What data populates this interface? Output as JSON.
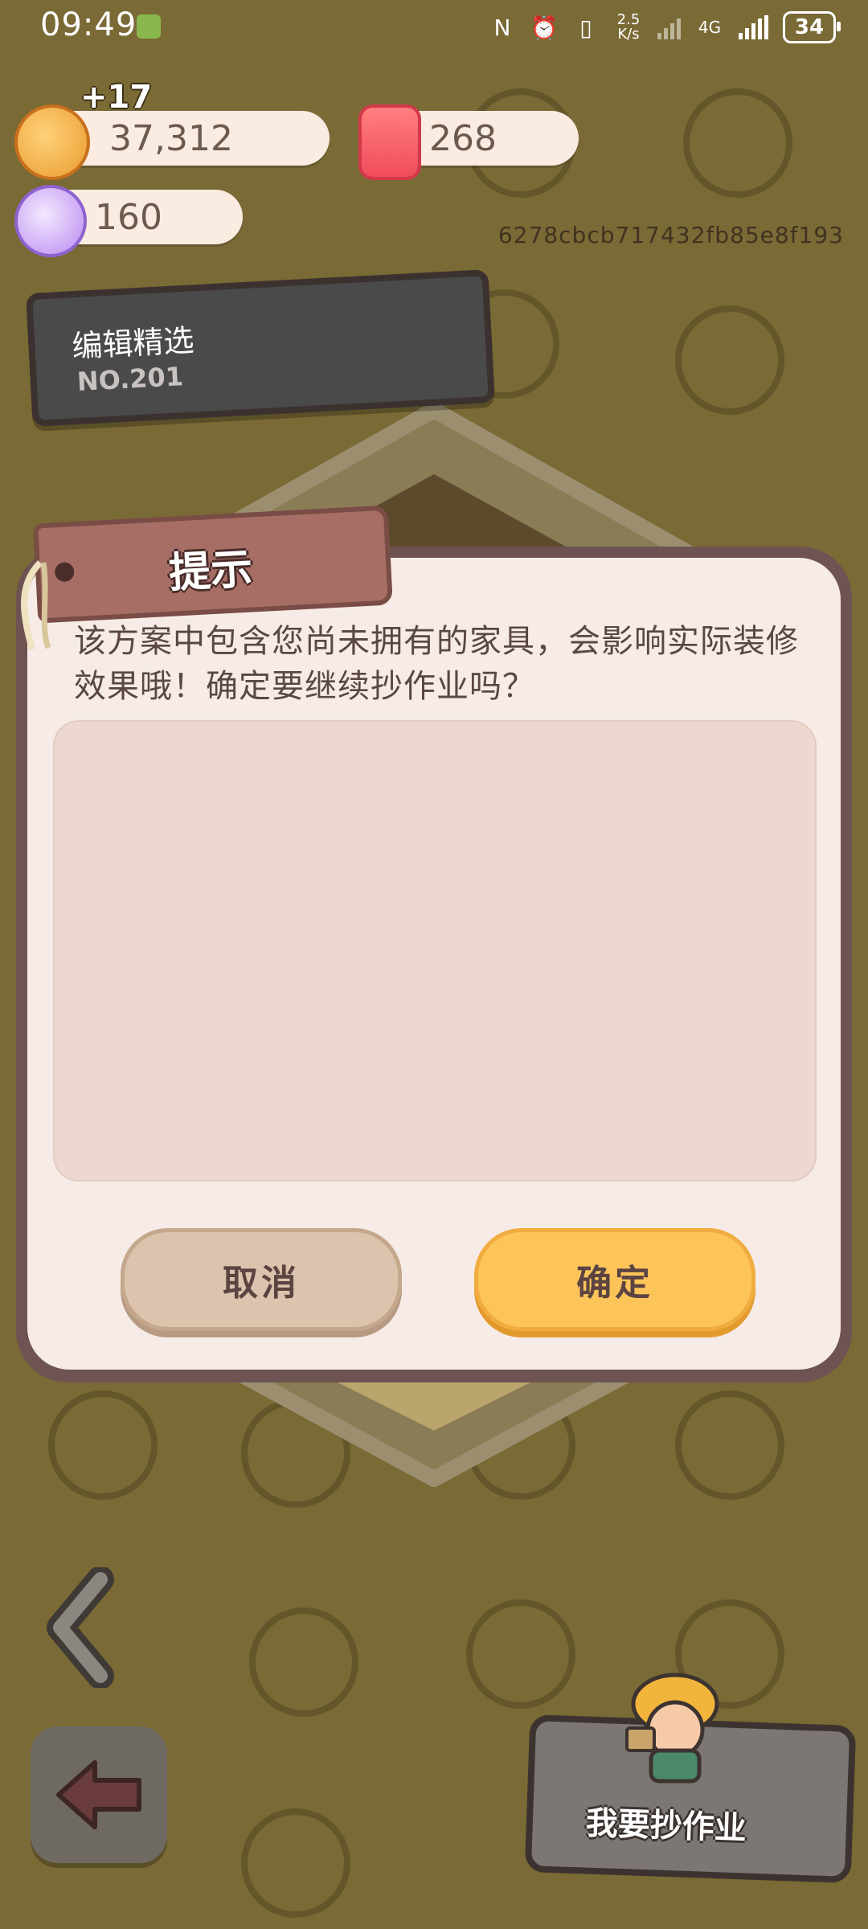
{
  "status_bar": {
    "time": "09:49",
    "net_speed_value": "2.5",
    "net_speed_unit": "K/s",
    "network_type": "4G",
    "battery": "34"
  },
  "currencies": {
    "coins": "37,312",
    "coins_gain": "+17",
    "candles": "268",
    "candy": "160"
  },
  "user_id": "6278cbcb717432fb85e8f193",
  "editor_tag": {
    "title": "编辑精选",
    "number": "NO.201"
  },
  "dialog": {
    "title": "提示",
    "message": "该方案中包含您尚未拥有的家具，会影响实际装修效果哦！确定要继续抄作业吗？",
    "cancel_label": "取消",
    "confirm_label": "确定"
  },
  "bottom": {
    "copy_homework_label": "我要抄作业"
  },
  "colors": {
    "background": "#7a6a35",
    "dialog_bg": "#f6ebe6",
    "dialog_border": "#6e5352",
    "confirm_button": "#fdc45a",
    "cancel_button": "#dcc3ad"
  }
}
